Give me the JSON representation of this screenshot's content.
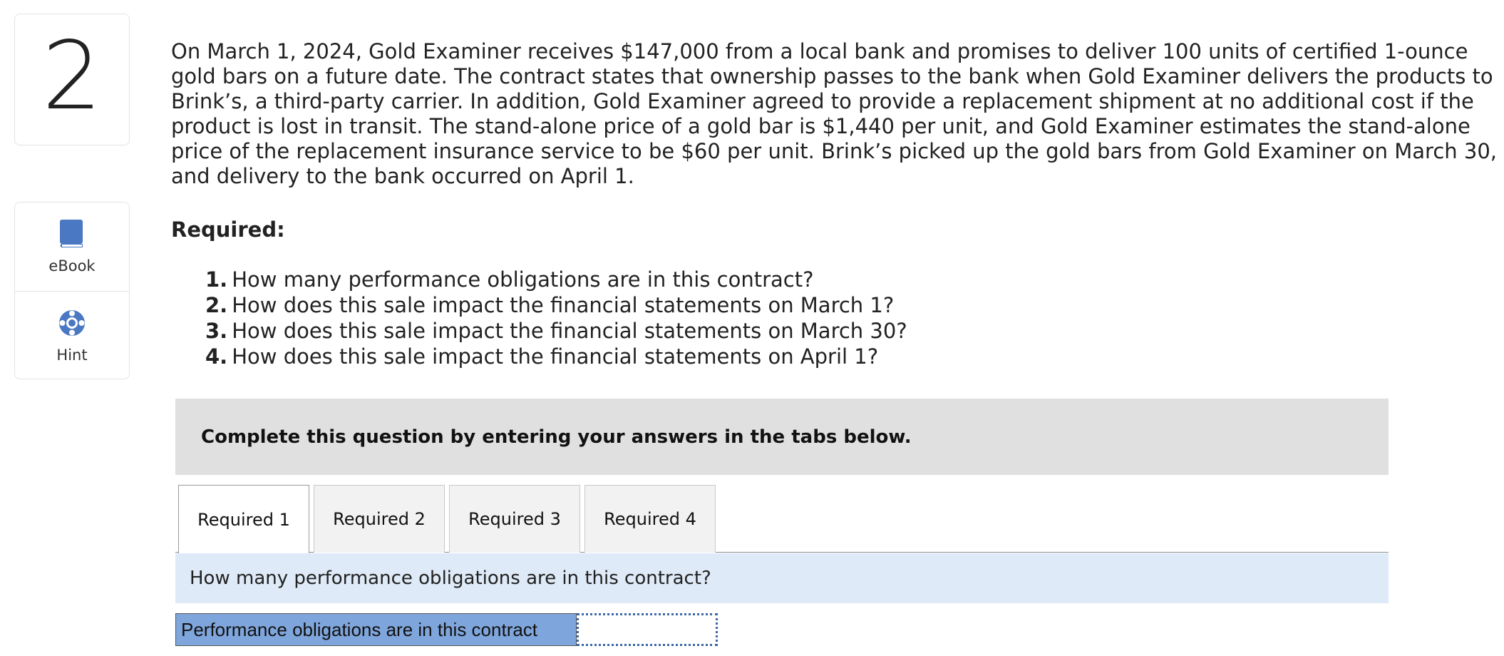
{
  "question_number": "2",
  "tools": {
    "ebook_label": "eBook",
    "hint_label": "Hint"
  },
  "problem_text": "On March 1, 2024, Gold Examiner receives $147,000 from a local bank and promises to deliver 100 units of certified 1-ounce gold bars on a future date. The contract states that ownership passes to the bank when Gold Examiner delivers the products to Brink’s, a third-party carrier. In addition, Gold Examiner agreed to provide a replacement shipment at no additional cost if the product is lost in transit. The stand-alone price of a gold bar is $1,440 per unit, and Gold Examiner estimates the stand-alone price of the replacement insurance service to be $60 per unit. Brink’s picked up the gold bars from Gold Examiner on March 30, and delivery to the bank occurred on April 1.",
  "required_heading": "Required:",
  "requirements": [
    {
      "num": "1.",
      "text": "How many performance obligations are in this contract?"
    },
    {
      "num": "2.",
      "text": "How does this sale impact the financial statements on March 1?"
    },
    {
      "num": "3.",
      "text": "How does this sale impact the financial statements on March 30?"
    },
    {
      "num": "4.",
      "text": "How does this sale impact the financial statements on April 1?"
    }
  ],
  "instruction": "Complete this question by entering your answers in the tabs below.",
  "tabs": [
    {
      "label": "Required 1",
      "active": true
    },
    {
      "label": "Required 2",
      "active": false
    },
    {
      "label": "Required 3",
      "active": false
    },
    {
      "label": "Required 4",
      "active": false
    }
  ],
  "panel_question": "How many performance obligations are in this contract?",
  "answer": {
    "label": "Performance obligations are in this contract",
    "value": ""
  },
  "colors": {
    "accent_blue": "#4a78c2",
    "panel_blue": "#deeaf7",
    "label_blue": "#7fa6dc",
    "banner_gray": "#e0e0e0"
  }
}
